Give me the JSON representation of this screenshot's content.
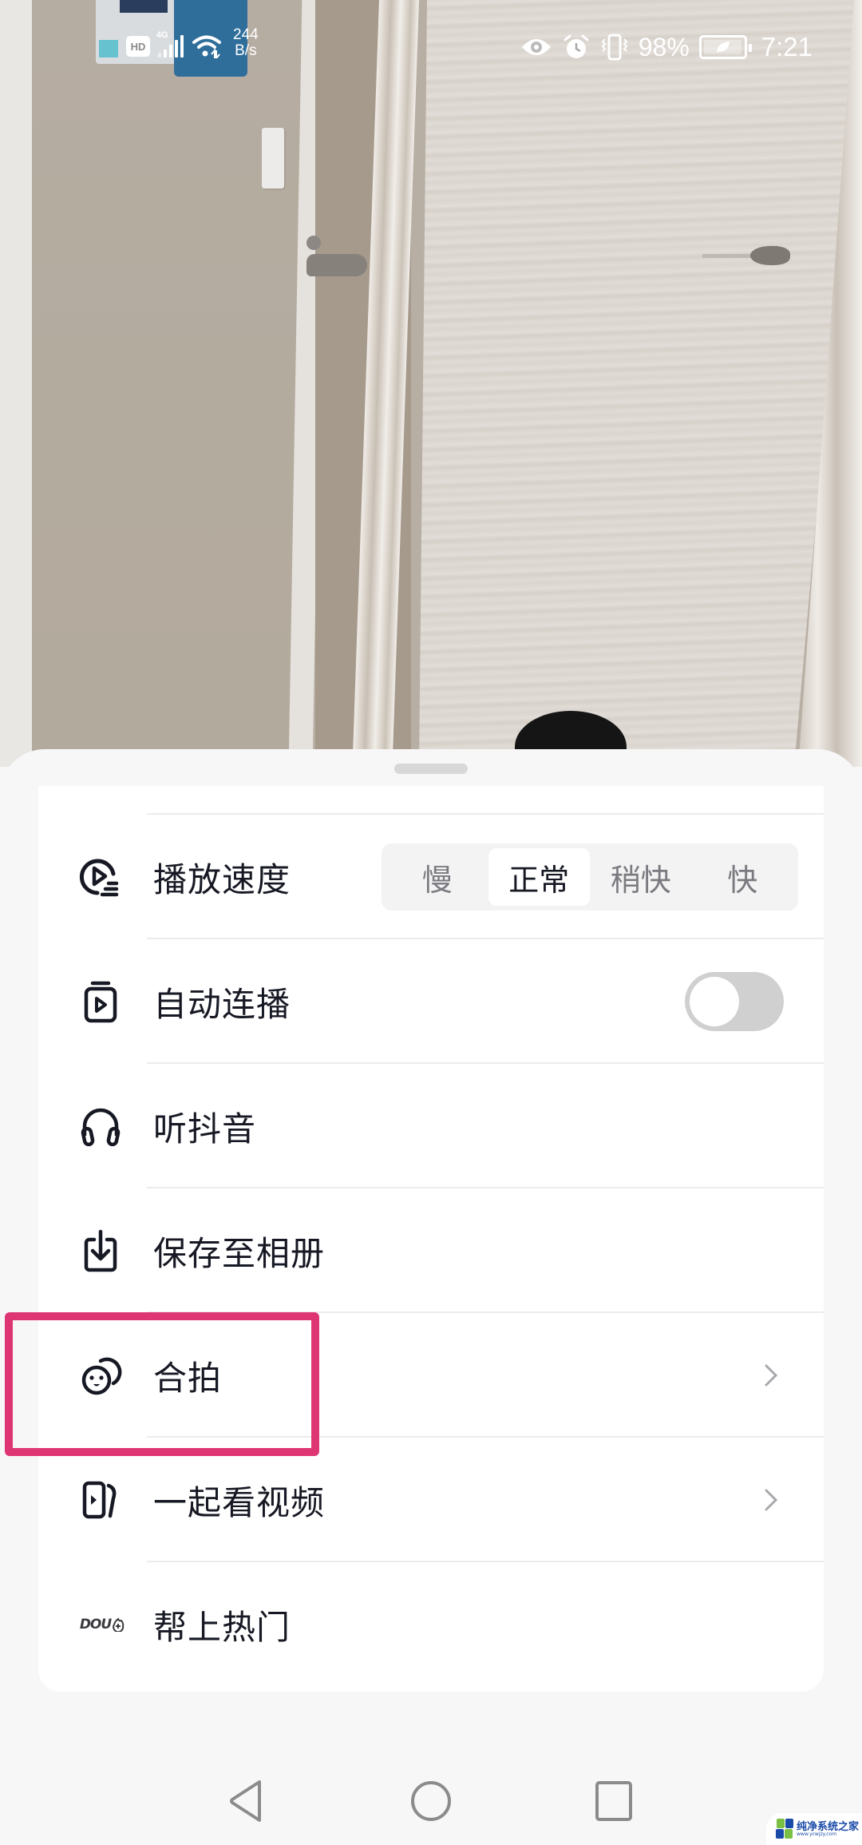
{
  "status_bar": {
    "hd_label": "HD",
    "network_type": "4G",
    "net_speed_value": "244",
    "net_speed_unit": "B/s",
    "battery_percent": "98%",
    "time": "7:21",
    "icons": [
      "hd-icon",
      "signal-icon",
      "wifi-icon",
      "eye-comfort-icon",
      "alarm-icon",
      "vibrate-icon",
      "battery-icon"
    ]
  },
  "sheet": {
    "rows": [
      {
        "id": "playback-speed",
        "icon": "playback-speed-icon",
        "label": "播放速度",
        "control": "segmented",
        "options": [
          "慢",
          "正常",
          "稍快",
          "快"
        ],
        "selected": "正常"
      },
      {
        "id": "autoplay",
        "icon": "autoplay-icon",
        "label": "自动连播",
        "control": "toggle",
        "toggle_on": false
      },
      {
        "id": "listen-douyin",
        "icon": "headphones-icon",
        "label": "听抖音"
      },
      {
        "id": "save-to-album",
        "icon": "download-icon",
        "label": "保存至相册"
      },
      {
        "id": "duet",
        "icon": "duet-icon",
        "label": "合拍",
        "chevron": true,
        "highlighted": true
      },
      {
        "id": "watch-together",
        "icon": "watch-together-icon",
        "label": "一起看视频",
        "chevron": true
      },
      {
        "id": "dou-plus",
        "icon": "dou-plus-icon",
        "icon_text": "DOU",
        "label": "帮上热门"
      }
    ]
  },
  "nav_bar": {
    "buttons": [
      "back",
      "home",
      "recents"
    ]
  },
  "watermark": {
    "title": "纯净系统之家",
    "url": "www.ycwjzy.com"
  },
  "colors": {
    "highlight": "#de3573",
    "text_primary": "#161823",
    "text_secondary": "#7a7a80",
    "toggle_off": "#d0d0d0",
    "sheet_bg": "#f7f7f7"
  }
}
